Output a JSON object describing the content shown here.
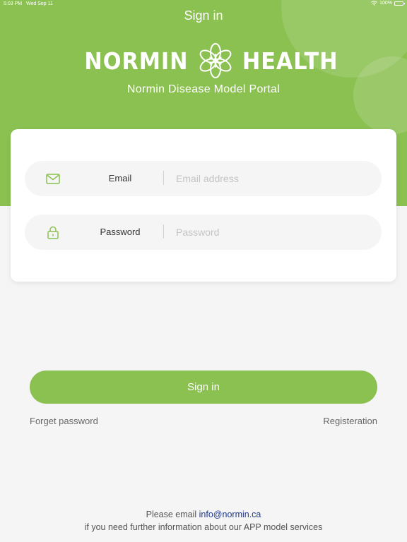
{
  "status_bar": {
    "time": "5:03 PM",
    "date": "Wed Sep 11",
    "battery": "100%",
    "icons": [
      "wifi-icon",
      "battery-icon"
    ]
  },
  "header": {
    "title": "Sign in",
    "logo": {
      "left_word": "NORMIN",
      "right_word": "HEALTH"
    },
    "subtitle": "Normin Disease Model Portal",
    "background_color": "#8bc151"
  },
  "form": {
    "email": {
      "icon": "envelope-icon",
      "label": "Email",
      "placeholder": "Email address",
      "value": ""
    },
    "password": {
      "icon": "lock-icon",
      "label": "Password",
      "placeholder": "Password",
      "value": ""
    }
  },
  "actions": {
    "signin_label": "Sign in",
    "forget_password": "Forget password",
    "registration": "Registeration"
  },
  "footer": {
    "line1_prefix": "Please email ",
    "email": "info@normin.ca",
    "line2": "if you need further information about our APP model services"
  },
  "colors": {
    "accent": "#8bc151",
    "link": "#1f3a93"
  }
}
